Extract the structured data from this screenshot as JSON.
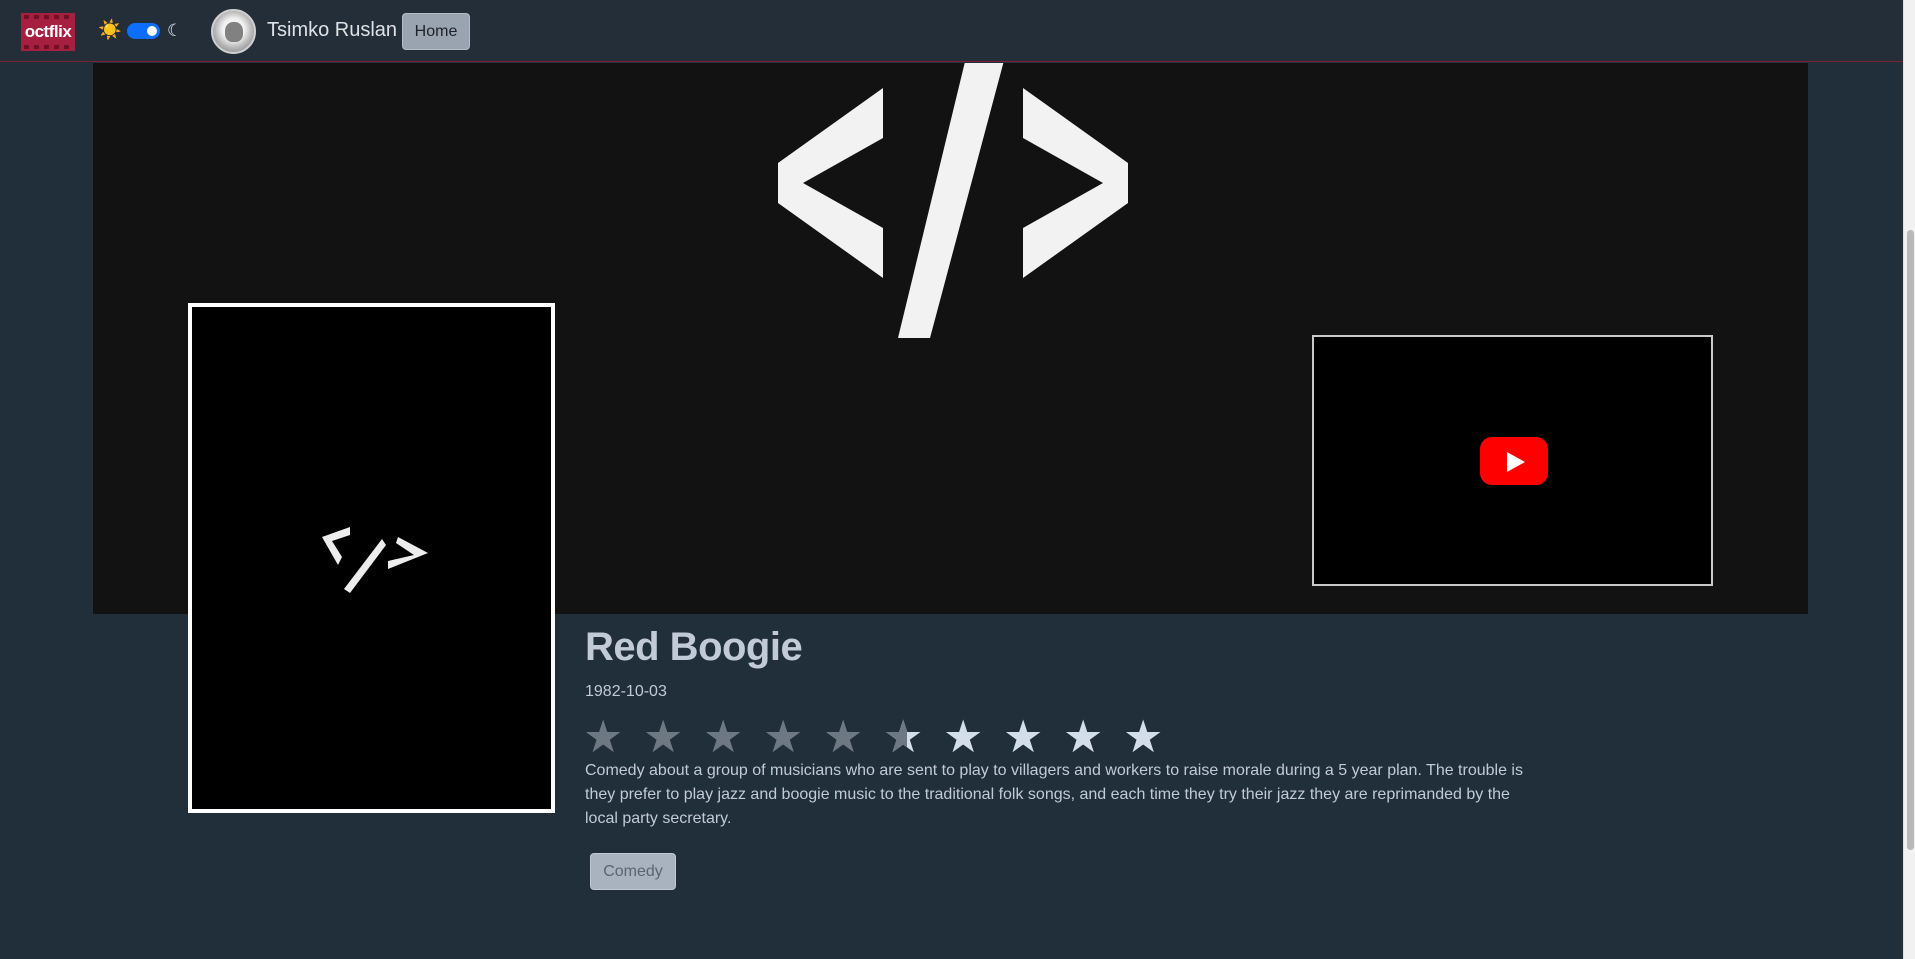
{
  "navbar": {
    "logo_text": "octflix",
    "theme_light_icon": "☀️",
    "theme_dark_icon": "☾",
    "theme_toggle_on": true,
    "user_name": "Tsimko Ruslan",
    "home_label": "Home"
  },
  "movie": {
    "title": "Red Boogie",
    "release_date": "1982-10-03",
    "rating": {
      "value": 5.5,
      "max": 10
    },
    "description": "Comedy about a group of musicians who are sent to play to villagers and workers to raise morale during a 5 year plan. The trouble is they prefer to play jazz and boogie music to the traditional folk songs, and each time they try their jazz they are reprimanded by the local party secretary.",
    "genres": [
      "Comedy"
    ]
  },
  "icons": {
    "backdrop": "code-icon",
    "poster": "code-icon",
    "trailer": "youtube-play-icon",
    "star": "★"
  },
  "colors": {
    "accent": "#a61f3f",
    "page_bg": "#212f3a",
    "toggle": "#0d6efd",
    "youtube": "#ff0000"
  }
}
